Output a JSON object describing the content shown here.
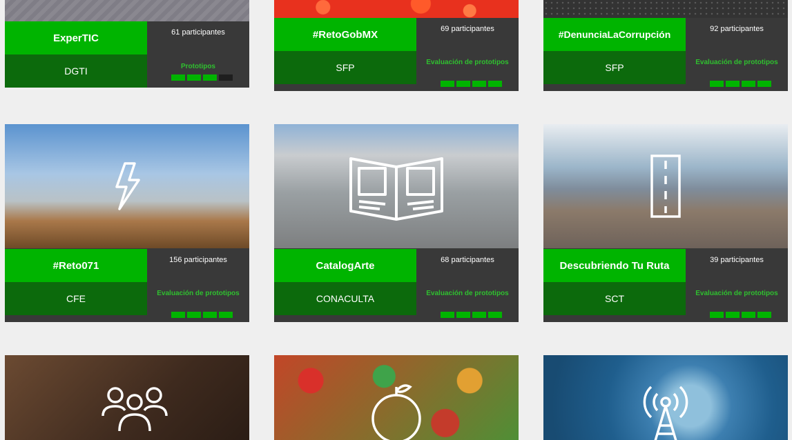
{
  "cards": [
    {
      "title": "ExperTIC",
      "org": "DGTI",
      "participants": "61 participantes",
      "stage": "Prototipos",
      "progress_filled": 3,
      "progress_total": 4
    },
    {
      "title": "#RetoGobMX",
      "org": "SFP",
      "participants": "69 participantes",
      "stage": "Evaluación de prototipos",
      "progress_filled": 4,
      "progress_total": 4
    },
    {
      "title": "#DenunciaLaCorrupción",
      "org": "SFP",
      "participants": "92 participantes",
      "stage": "Evaluación de prototipos",
      "progress_filled": 4,
      "progress_total": 4
    },
    {
      "title": "#Reto071",
      "org": "CFE",
      "participants": "156 participantes",
      "stage": "Evaluación de prototipos",
      "progress_filled": 4,
      "progress_total": 4,
      "icon": "lightning-icon"
    },
    {
      "title": "CatalogArte",
      "org": "CONACULTA",
      "participants": "68 participantes",
      "stage": "Evaluación de prototipos",
      "progress_filled": 4,
      "progress_total": 4,
      "icon": "open-book-icon"
    },
    {
      "title": "Descubriendo Tu Ruta",
      "org": "SCT",
      "participants": "39 participantes",
      "stage": "Evaluación de prototipos",
      "progress_filled": 4,
      "progress_total": 4,
      "icon": "road-icon"
    },
    {
      "icon": "people-group-icon"
    },
    {
      "icon": "fruit-icon"
    },
    {
      "icon": "radio-tower-icon"
    }
  ],
  "colors": {
    "accent": "#00b400",
    "dark_green": "#0c6a0c",
    "panel": "#393939",
    "background": "#efefef"
  }
}
